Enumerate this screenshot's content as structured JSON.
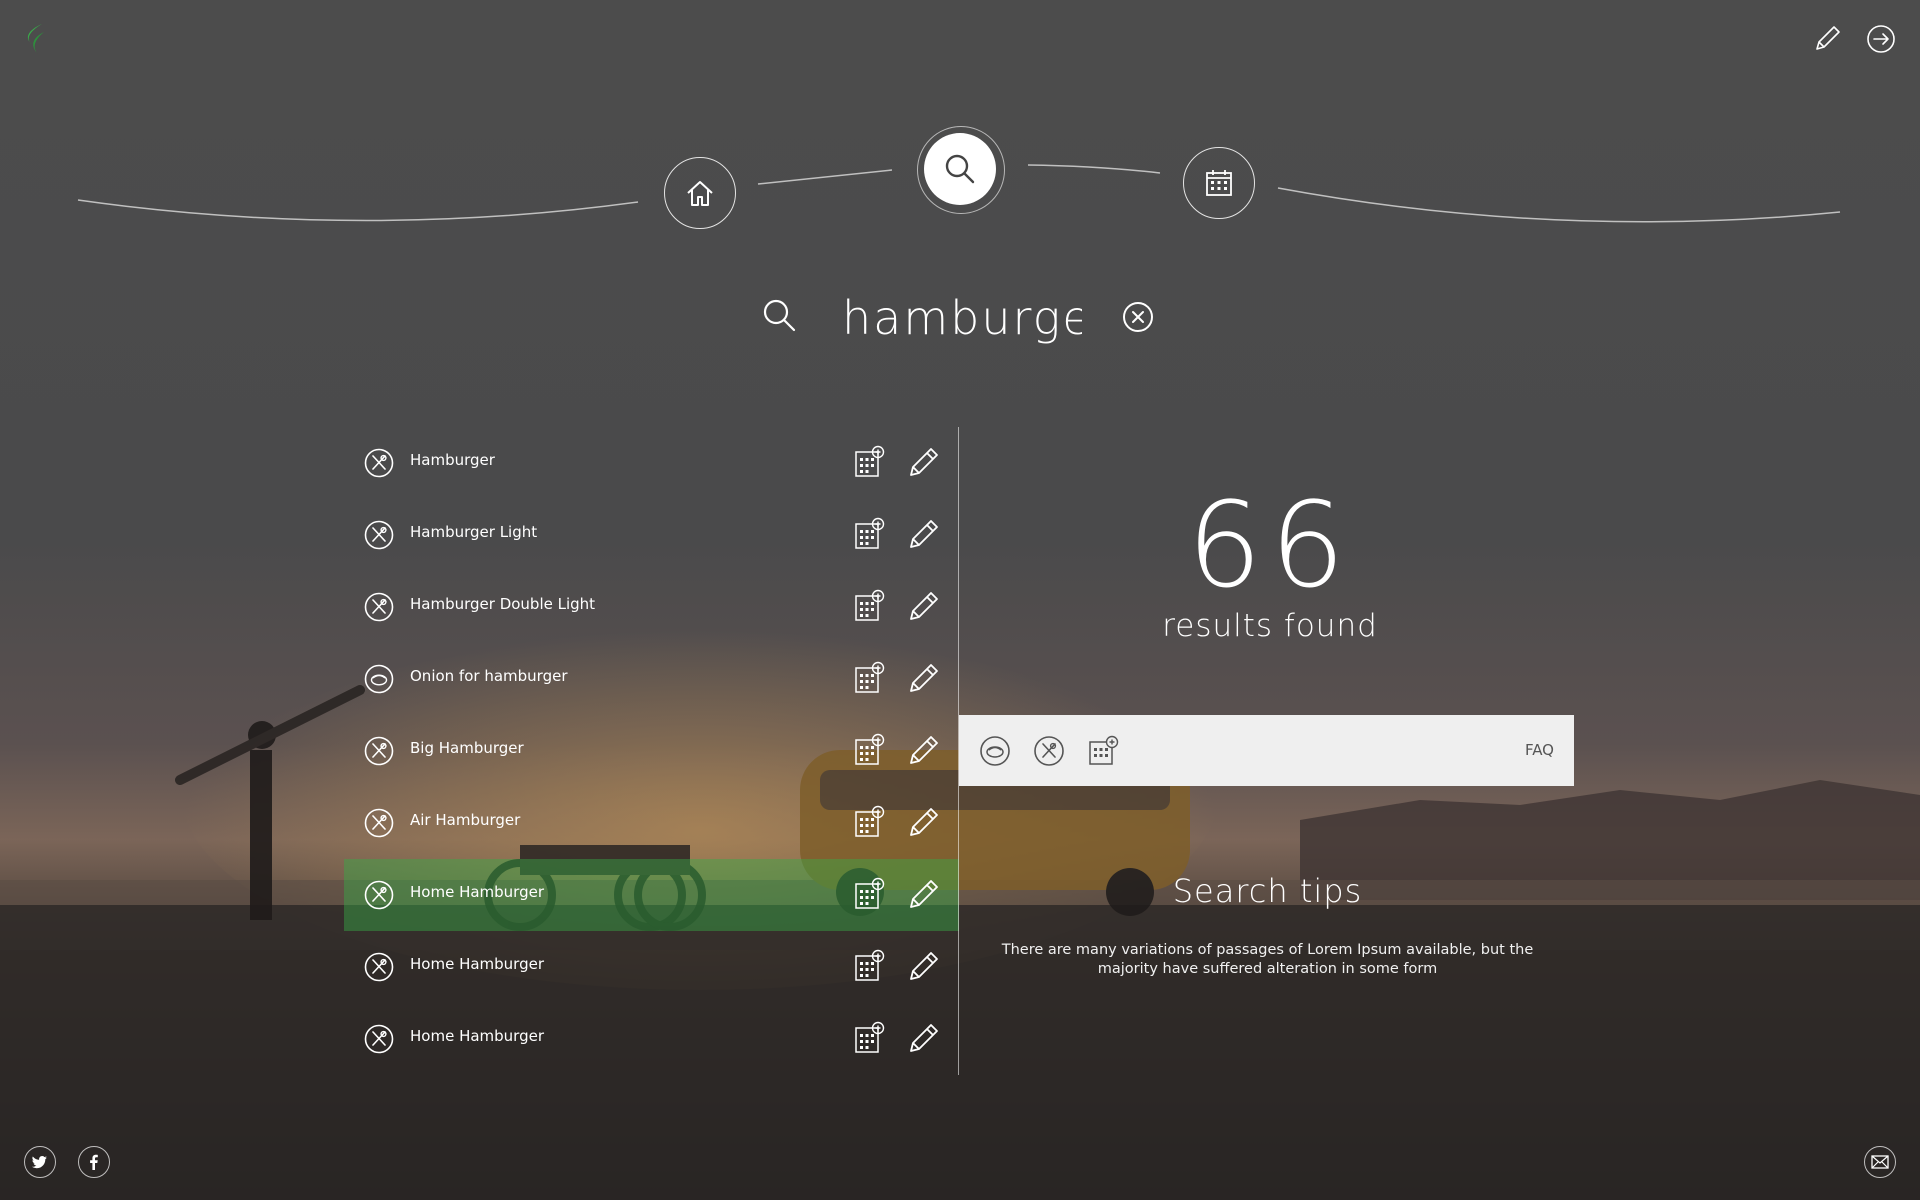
{
  "app": {
    "logo": "leaf-logo",
    "accent_color": "#3aa84a"
  },
  "header": {
    "icons": [
      "pencil-icon",
      "logout-icon"
    ]
  },
  "nav": {
    "items": [
      {
        "name": "home",
        "icon": "home-icon"
      },
      {
        "name": "search",
        "icon": "search-icon",
        "active": true
      },
      {
        "name": "calendar",
        "icon": "calendar-icon"
      }
    ]
  },
  "search": {
    "value": "hamburger",
    "icon": "search-icon",
    "clear_icon": "clear-icon"
  },
  "results": {
    "items": [
      {
        "label": "Hamburger",
        "icon": "cutlery-icon"
      },
      {
        "label": "Hamburger Light",
        "icon": "cutlery-icon"
      },
      {
        "label": "Hamburger Double Light",
        "icon": "cutlery-icon"
      },
      {
        "label": "Onion for hamburger",
        "icon": "ingredient-icon"
      },
      {
        "label": "Big Hamburger",
        "icon": "cutlery-icon"
      },
      {
        "label": "Air Hamburger",
        "icon": "cutlery-icon"
      },
      {
        "label": "Home Hamburger",
        "icon": "cutlery-icon",
        "active": true
      },
      {
        "label": "Home Hamburger",
        "icon": "cutlery-icon"
      },
      {
        "label": "Home Hamburger",
        "icon": "cutlery-icon"
      }
    ]
  },
  "summary": {
    "count": "66",
    "label": "results found"
  },
  "filters": {
    "icons": [
      "ingredient-icon",
      "cutlery-icon",
      "calendar-add-icon"
    ],
    "faq_label": "FAQ"
  },
  "tips": {
    "title": "Search tips",
    "text": "There are many variations of passages of Lorem Ipsum available, but the majority have suffered alteration in some form"
  },
  "footer": {
    "icons": [
      "twitter-icon",
      "facebook-icon",
      "mail-icon"
    ]
  }
}
